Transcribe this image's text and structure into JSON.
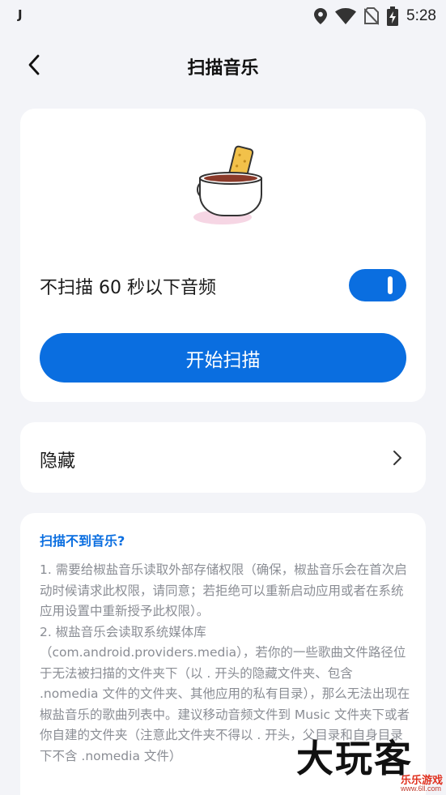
{
  "status_bar": {
    "left_glyph": "J",
    "time": "5:28",
    "icons": [
      "location-icon",
      "wifi-icon",
      "no-sim-icon",
      "battery-charging-icon"
    ]
  },
  "header": {
    "title": "扫描音乐",
    "back_icon": "back-arrow-icon"
  },
  "scan_card": {
    "illustration": "coffee-cup-with-biscuit",
    "toggle_label": "不扫描 60 秒以下音频",
    "toggle_on": true,
    "button_label": "开始扫描",
    "accent_color": "#0a6ee0"
  },
  "hide_card": {
    "label": "隐藏",
    "chevron_icon": "chevron-right-icon"
  },
  "help_card": {
    "title": "扫描不到音乐?",
    "paragraph1": "1. 需要给椒盐音乐读取外部存储权限（确保，椒盐音乐会在首次启动时候请求此权限，请同意；若拒绝可以重新启动应用或者在系统应用设置中重新授予此权限）。",
    "paragraph2": "2. 椒盐音乐会读取系统媒体库（com.android.providers.media），若你的一些歌曲文件路径位于无法被扫描的文件夹下（以 . 开头的隐藏文件夹、包含 .nomedia 文件的文件夹、其他应用的私有目录），那么无法出现在椒盐音乐的歌曲列表中。建议移动音频文件到 Music 文件夹下或者你自建的文件夹（注意此文件夹不得以 . 开头，父目录和自身目录下不含 .nomedia 文件）"
  },
  "watermark": {
    "big": "大玩客",
    "small": "乐乐游戏",
    "url": "www.6ll.com"
  }
}
